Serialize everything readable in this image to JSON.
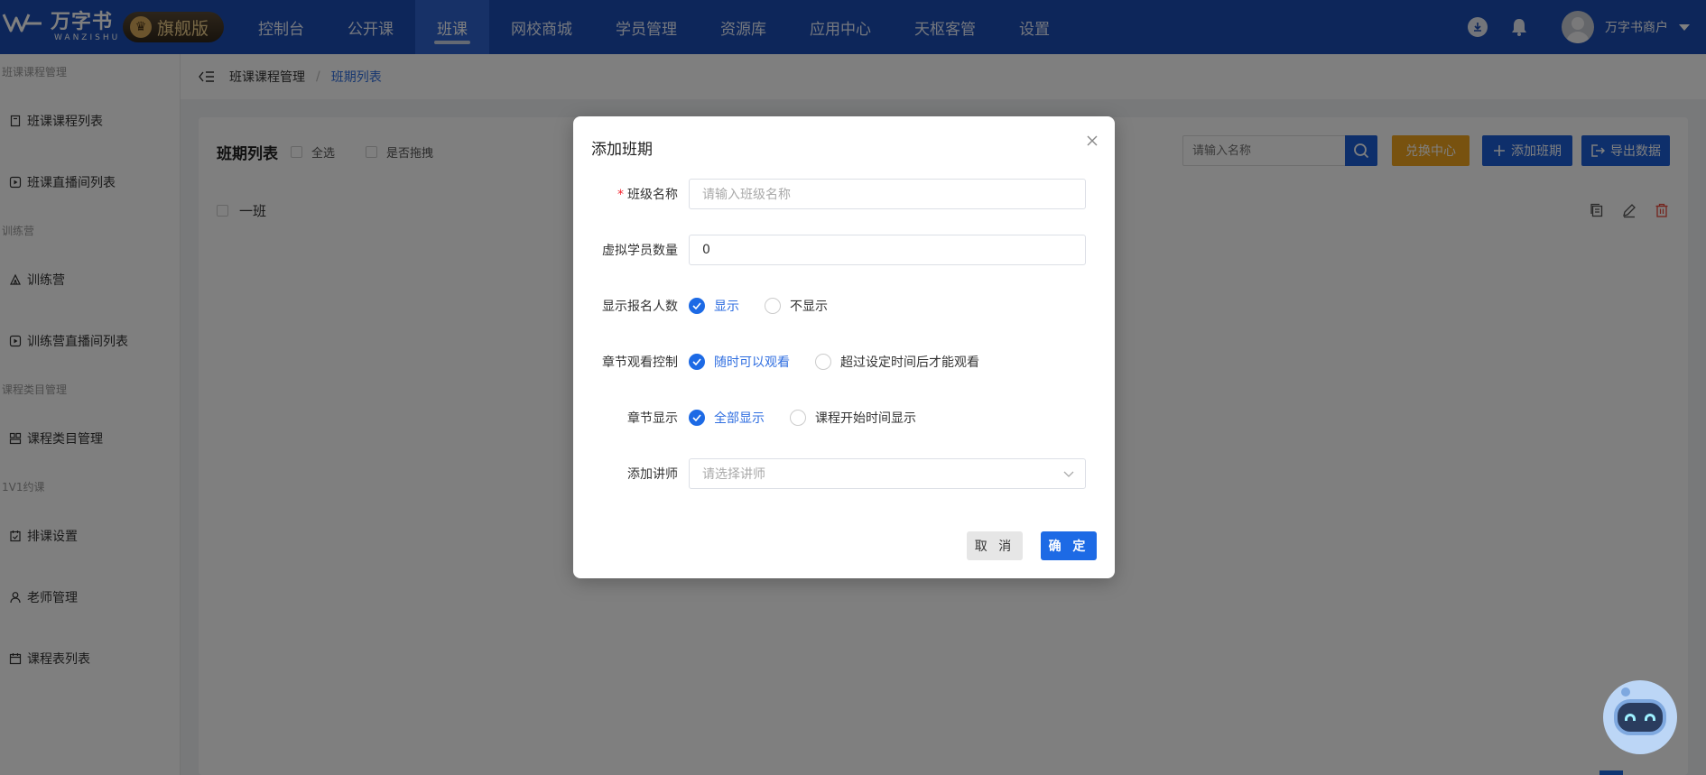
{
  "brand": {
    "logo_text": "万字书",
    "logo_sub": "WANZISHU",
    "edition": "旗舰版"
  },
  "nav": {
    "items": [
      {
        "label": "控制台",
        "active": false
      },
      {
        "label": "公开课",
        "active": false
      },
      {
        "label": "班课",
        "active": true
      },
      {
        "label": "网校商城",
        "active": false
      },
      {
        "label": "学员管理",
        "active": false
      },
      {
        "label": "资源库",
        "active": false
      },
      {
        "label": "应用中心",
        "active": false
      },
      {
        "label": "天枢客管",
        "active": false
      },
      {
        "label": "设置",
        "active": false
      }
    ],
    "user_name": "万字书商户"
  },
  "sidebar": {
    "groups": [
      {
        "title": "班课课程管理",
        "items": [
          {
            "label": "班课课程列表",
            "icon": "book-icon"
          },
          {
            "label": "班课直播间列表",
            "icon": "live-icon"
          }
        ]
      },
      {
        "title": "训练营",
        "items": [
          {
            "label": "训练营",
            "icon": "camp-icon"
          },
          {
            "label": "训练营直播间列表",
            "icon": "live-icon"
          }
        ]
      },
      {
        "title": "课程类目管理",
        "items": [
          {
            "label": "课程类目管理",
            "icon": "category-icon"
          }
        ]
      },
      {
        "title": "1V1约课",
        "items": [
          {
            "label": "排课设置",
            "icon": "schedule-icon"
          },
          {
            "label": "老师管理",
            "icon": "user-icon"
          },
          {
            "label": "课程表列表",
            "icon": "calendar-icon"
          }
        ]
      }
    ]
  },
  "breadcrumb": {
    "parent": "班课课程管理",
    "separator": "/",
    "current": "班期列表"
  },
  "list": {
    "title": "班期列表",
    "select_all": "全选",
    "drag_toggle": "是否拖拽",
    "search_placeholder": "请输入名称",
    "exchange_btn": "兑换中心",
    "add_btn": "添加班期",
    "export_btn": "导出数据",
    "rows": [
      {
        "name": "一班"
      }
    ]
  },
  "dialog": {
    "title": "添加班期",
    "fields": {
      "class_name": {
        "label": "班级名称",
        "placeholder": "请输入班级名称",
        "required": true
      },
      "virtual_count": {
        "label": "虚拟学员数量",
        "value": "0"
      },
      "show_enroll": {
        "label": "显示报名人数",
        "options": [
          "显示",
          "不显示"
        ],
        "selected": "显示"
      },
      "chapter_control": {
        "label": "章节观看控制",
        "options": [
          "随时可以观看",
          "超过设定时间后才能观看"
        ],
        "selected": "随时可以观看"
      },
      "chapter_display": {
        "label": "章节显示",
        "options": [
          "全部显示",
          "课程开始时间显示"
        ],
        "selected": "全部显示"
      },
      "teacher": {
        "label": "添加讲师",
        "placeholder": "请选择讲师"
      }
    },
    "cancel": "取 消",
    "confirm": "确 定"
  },
  "colors": {
    "topbar": "#1a4db4",
    "primary": "#1d6ae5",
    "orange": "#f0a51e"
  }
}
